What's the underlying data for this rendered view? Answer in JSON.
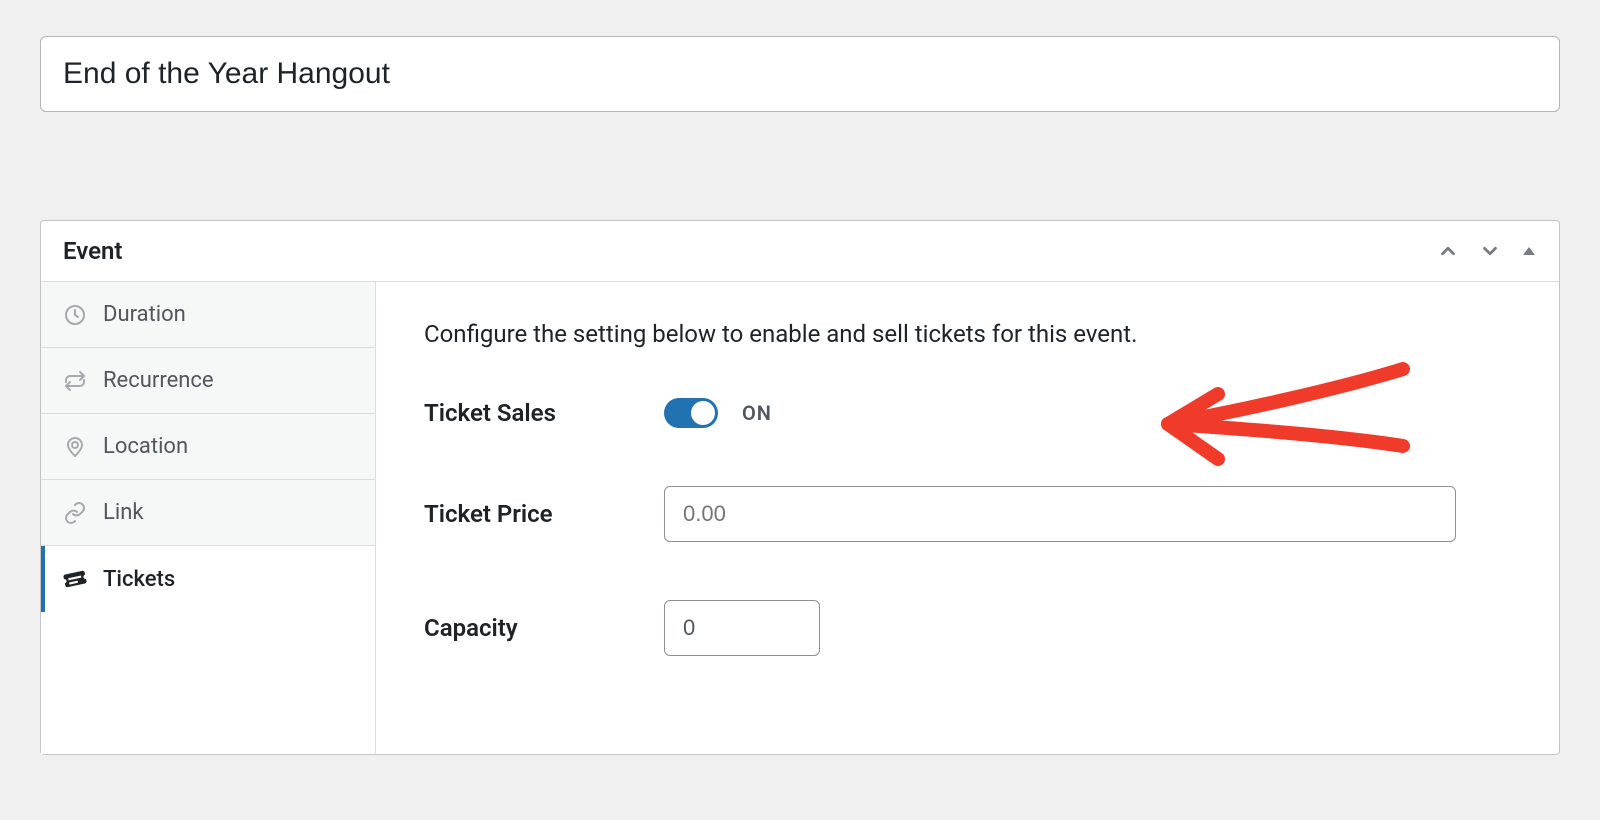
{
  "title": {
    "value": "End of the Year Hangout"
  },
  "panel": {
    "heading": "Event",
    "sidebar": {
      "items": [
        {
          "label": "Duration",
          "icon": "clock-icon",
          "active": false
        },
        {
          "label": "Recurrence",
          "icon": "repeat-icon",
          "active": false
        },
        {
          "label": "Location",
          "icon": "pin-icon",
          "active": false
        },
        {
          "label": "Link",
          "icon": "link-icon",
          "active": false
        },
        {
          "label": "Tickets",
          "icon": "ticket-icon",
          "active": true
        }
      ]
    },
    "content": {
      "description": "Configure the setting below to enable and sell tickets for this event.",
      "ticket_sales": {
        "label": "Ticket Sales",
        "state": "ON",
        "on": true
      },
      "ticket_price": {
        "label": "Ticket Price",
        "placeholder": "0.00",
        "value": ""
      },
      "capacity": {
        "label": "Capacity",
        "value": "0"
      }
    }
  },
  "colors": {
    "accent": "#2271b1",
    "annotation": "#f13b2a"
  }
}
